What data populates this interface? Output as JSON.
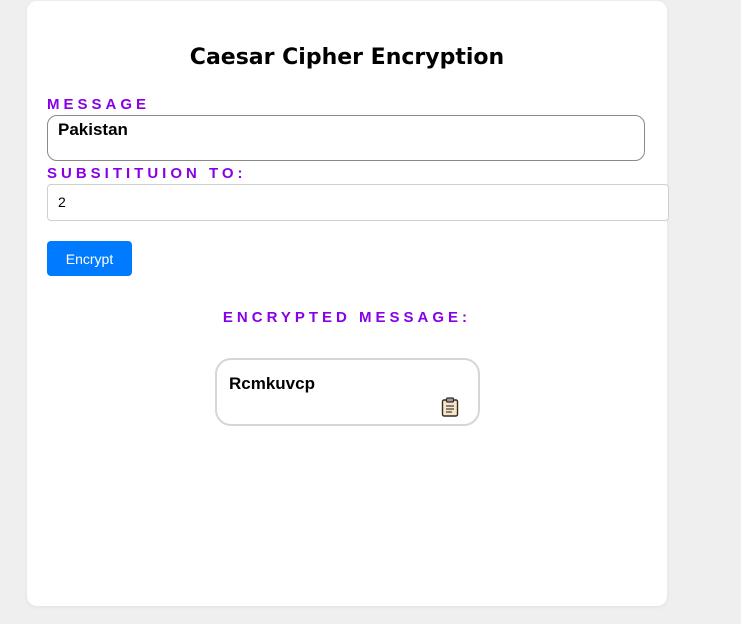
{
  "title": "Caesar Cipher Encryption",
  "message": {
    "label": "MESSAGE",
    "value": "Pakistan"
  },
  "substitution": {
    "label": "SUBSITITUION TO:",
    "value": "2"
  },
  "encrypt_button": {
    "label": "Encrypt",
    "color": "#007bff"
  },
  "result": {
    "label": "ENCRYPTED MESSAGE:",
    "value": "Rcmkuvcp",
    "copy_icon": "clipboard-icon"
  },
  "colors": {
    "accent": "#8a00e6",
    "background": "#efefef",
    "card": "#ffffff"
  }
}
